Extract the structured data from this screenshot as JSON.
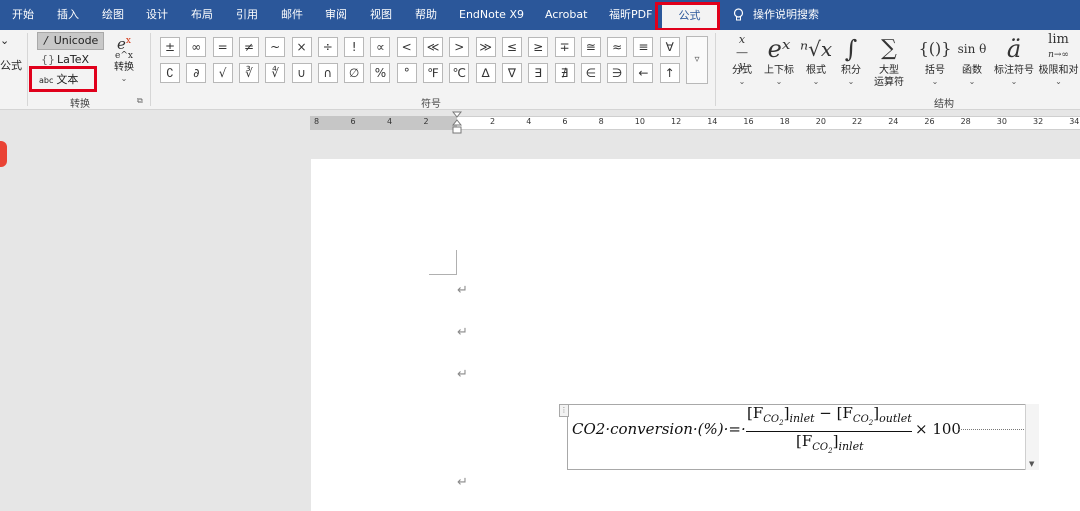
{
  "menu": {
    "tabs": [
      "开始",
      "插入",
      "绘图",
      "设计",
      "布局",
      "引用",
      "邮件",
      "审阅",
      "视图",
      "帮助",
      "EndNote X9",
      "Acrobat",
      "福昕PDF"
    ],
    "active_tab": "公式",
    "tell_me": "操作说明搜索"
  },
  "ribbon": {
    "left_label": "公式",
    "convert": {
      "unicode": "Unicode",
      "latex": "LaTeX",
      "text_prefix": "abc",
      "text": "文本",
      "convert_icon_top": "e",
      "convert_icon_bottom": "e^x",
      "convert_label": "转换",
      "group": "转换"
    },
    "symbols": {
      "row1": [
        "±",
        "∞",
        "=",
        "≠",
        "~",
        "×",
        "÷",
        "!",
        "∝",
        "<",
        "≪",
        ">",
        "≫",
        "≤",
        "≥",
        "∓",
        "≅",
        "≈",
        "≡",
        "∀"
      ],
      "row2": [
        "∁",
        "∂",
        "√",
        "∛",
        "∜",
        "∪",
        "∩",
        "∅",
        "%",
        "°",
        "℉",
        "℃",
        "∆",
        "∇",
        "∃",
        "∄",
        "∈",
        "∋",
        "←",
        "↑"
      ],
      "more": "▿",
      "group": "符号"
    },
    "structures": {
      "items": [
        {
          "icon": "x/y",
          "label": "分式"
        },
        {
          "icon": "eˣ",
          "label": "上下标"
        },
        {
          "icon": "ⁿ√x",
          "label": "根式"
        },
        {
          "icon": "∫",
          "label": "积分"
        },
        {
          "icon": "∑",
          "label": "大型",
          "label2": "运算符"
        },
        {
          "icon": "{()}",
          "label": "括号"
        },
        {
          "icon": "sin θ",
          "label": "函数"
        },
        {
          "icon": "ä",
          "label": "标注符号"
        },
        {
          "icon": "lim",
          "label": "极限和对"
        }
      ],
      "group": "结构"
    }
  },
  "ruler": {
    "left_numbers": [
      "8",
      "6",
      "4",
      "2"
    ],
    "right_numbers": [
      "2",
      "4",
      "6",
      "8",
      "10",
      "12",
      "14",
      "16",
      "18",
      "20",
      "22",
      "24",
      "26",
      "28",
      "30",
      "32",
      "34"
    ]
  },
  "document": {
    "para_mark": "↵",
    "equation": {
      "lhs": "CO2·conversion·(%)·=·",
      "num_a": "[F",
      "num_a_sub": "CO",
      "num_a_sub2": "2",
      "num_a_tail": "]",
      "num_a_sub3": "inlet",
      "minus": "−",
      "num_b": "[F",
      "num_b_sub": "CO",
      "num_b_sub2": "2",
      "num_b_tail": "]",
      "num_b_sub3": "outlet",
      "den": "[F",
      "den_sub": "CO",
      "den_sub2": "2",
      "den_tail": "]",
      "den_sub3": "inlet",
      "times": "× 100"
    }
  },
  "colors": {
    "menubar": "#2b579a",
    "highlight": "#e0001b",
    "ribbon_bg": "#f3f3f3",
    "page_bg": "#ffffff",
    "canvas_bg": "#e6e6e6"
  }
}
